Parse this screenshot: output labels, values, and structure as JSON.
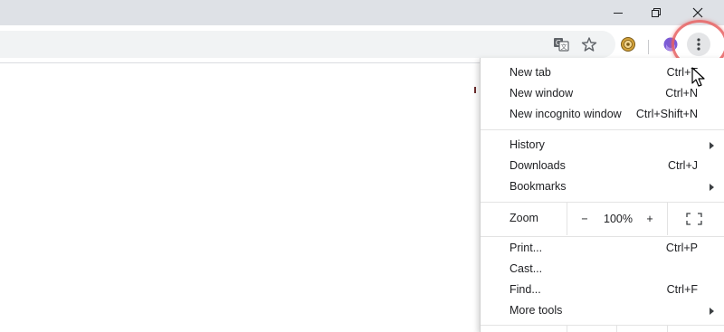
{
  "window_controls": {
    "minimize": "minimize",
    "restore": "restore",
    "close": "close"
  },
  "toolbar": {
    "icons": [
      "translate-icon",
      "star-icon",
      "extension-icon",
      "profile-icon",
      "kebab-menu-icon"
    ]
  },
  "menu": {
    "group1": [
      {
        "label": "New tab",
        "shortcut": "Ctrl+T"
      },
      {
        "label": "New window",
        "shortcut": "Ctrl+N"
      },
      {
        "label": "New incognito window",
        "shortcut": "Ctrl+Shift+N"
      }
    ],
    "group2": [
      {
        "label": "History",
        "shortcut": ""
      },
      {
        "label": "Downloads",
        "shortcut": "Ctrl+J"
      },
      {
        "label": "Bookmarks",
        "shortcut": ""
      }
    ],
    "zoom": {
      "label": "Zoom",
      "minus": "−",
      "value": "100%",
      "plus": "+"
    },
    "group3": [
      {
        "label": "Print...",
        "shortcut": "Ctrl+P"
      },
      {
        "label": "Cast...",
        "shortcut": ""
      },
      {
        "label": "Find...",
        "shortcut": "Ctrl+F"
      },
      {
        "label": "More tools",
        "shortcut": ""
      }
    ]
  },
  "colors": {
    "titlebar": "#dee1e6",
    "omnibox": "#f1f3f4",
    "highlight": "#e76060"
  }
}
